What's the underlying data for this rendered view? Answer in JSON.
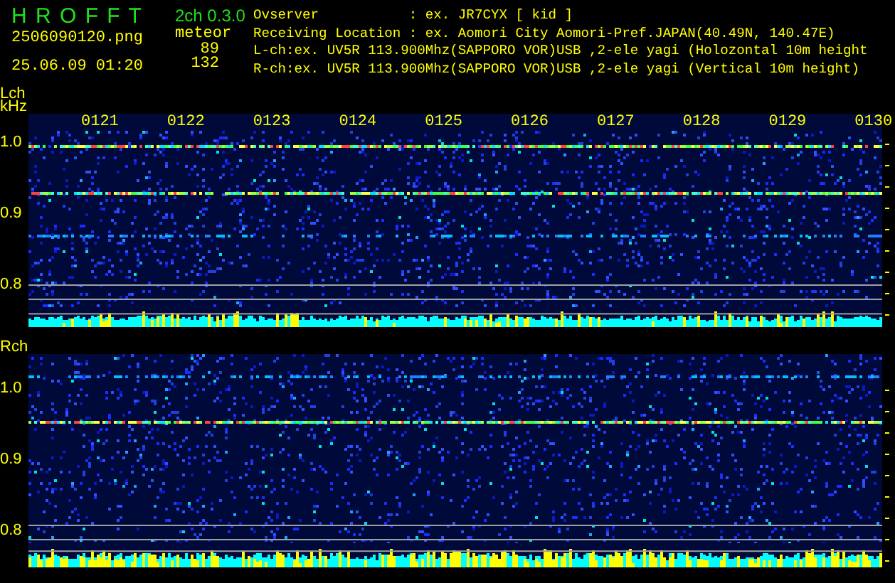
{
  "app": {
    "title": "H R O F F T",
    "version": "2ch 0.3.0"
  },
  "file": {
    "name": "2506090120.png",
    "timestamp": "25.06.09 01:20"
  },
  "meteor": {
    "label": "meteor",
    "counts": [
      "89",
      "132"
    ]
  },
  "info_lines": [
    "Ovserver           : ex. JR7CYX [ kid ]",
    "Receiving Location : ex. Aomori City Aomori-Pref.JAPAN(40.49N, 140.47E)",
    "L-ch:ex. UV5R 113.900Mhz(SAPPORO VOR)USB ,2-ele yagi (Holozontal 10m height",
    "R-ch:ex. UV5R 113.900Mhz(SAPPORO VOR)USB ,2-ele yagi (Vertical 10m height)"
  ],
  "channels": [
    {
      "label": "Lch",
      "unit": "kHz",
      "time_labels": [
        "0121",
        "0122",
        "0123",
        "0124",
        "0125",
        "0126",
        "0127",
        "0128",
        "0129",
        "0130"
      ],
      "yticks": [
        "1.0",
        "0.9",
        "0.8"
      ]
    },
    {
      "label": "Rch",
      "yticks": [
        "1.0",
        "0.9",
        "0.8"
      ]
    }
  ]
}
